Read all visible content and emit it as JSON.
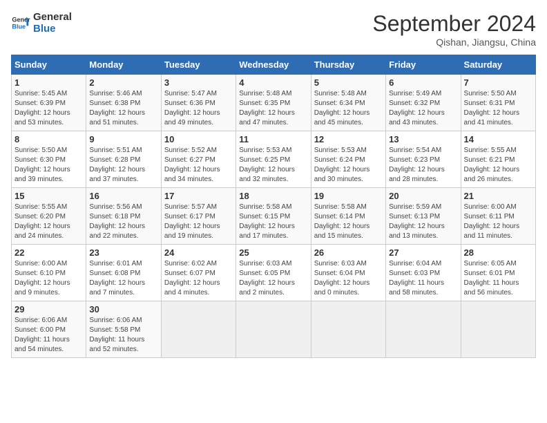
{
  "logo": {
    "line1": "General",
    "line2": "Blue"
  },
  "title": "September 2024",
  "location": "Qishan, Jiangsu, China",
  "weekdays": [
    "Sunday",
    "Monday",
    "Tuesday",
    "Wednesday",
    "Thursday",
    "Friday",
    "Saturday"
  ],
  "weeks": [
    [
      {
        "day": "1",
        "info": "Sunrise: 5:45 AM\nSunset: 6:39 PM\nDaylight: 12 hours\nand 53 minutes."
      },
      {
        "day": "2",
        "info": "Sunrise: 5:46 AM\nSunset: 6:38 PM\nDaylight: 12 hours\nand 51 minutes."
      },
      {
        "day": "3",
        "info": "Sunrise: 5:47 AM\nSunset: 6:36 PM\nDaylight: 12 hours\nand 49 minutes."
      },
      {
        "day": "4",
        "info": "Sunrise: 5:48 AM\nSunset: 6:35 PM\nDaylight: 12 hours\nand 47 minutes."
      },
      {
        "day": "5",
        "info": "Sunrise: 5:48 AM\nSunset: 6:34 PM\nDaylight: 12 hours\nand 45 minutes."
      },
      {
        "day": "6",
        "info": "Sunrise: 5:49 AM\nSunset: 6:32 PM\nDaylight: 12 hours\nand 43 minutes."
      },
      {
        "day": "7",
        "info": "Sunrise: 5:50 AM\nSunset: 6:31 PM\nDaylight: 12 hours\nand 41 minutes."
      }
    ],
    [
      {
        "day": "8",
        "info": "Sunrise: 5:50 AM\nSunset: 6:30 PM\nDaylight: 12 hours\nand 39 minutes."
      },
      {
        "day": "9",
        "info": "Sunrise: 5:51 AM\nSunset: 6:28 PM\nDaylight: 12 hours\nand 37 minutes."
      },
      {
        "day": "10",
        "info": "Sunrise: 5:52 AM\nSunset: 6:27 PM\nDaylight: 12 hours\nand 34 minutes."
      },
      {
        "day": "11",
        "info": "Sunrise: 5:53 AM\nSunset: 6:25 PM\nDaylight: 12 hours\nand 32 minutes."
      },
      {
        "day": "12",
        "info": "Sunrise: 5:53 AM\nSunset: 6:24 PM\nDaylight: 12 hours\nand 30 minutes."
      },
      {
        "day": "13",
        "info": "Sunrise: 5:54 AM\nSunset: 6:23 PM\nDaylight: 12 hours\nand 28 minutes."
      },
      {
        "day": "14",
        "info": "Sunrise: 5:55 AM\nSunset: 6:21 PM\nDaylight: 12 hours\nand 26 minutes."
      }
    ],
    [
      {
        "day": "15",
        "info": "Sunrise: 5:55 AM\nSunset: 6:20 PM\nDaylight: 12 hours\nand 24 minutes."
      },
      {
        "day": "16",
        "info": "Sunrise: 5:56 AM\nSunset: 6:18 PM\nDaylight: 12 hours\nand 22 minutes."
      },
      {
        "day": "17",
        "info": "Sunrise: 5:57 AM\nSunset: 6:17 PM\nDaylight: 12 hours\nand 19 minutes."
      },
      {
        "day": "18",
        "info": "Sunrise: 5:58 AM\nSunset: 6:15 PM\nDaylight: 12 hours\nand 17 minutes."
      },
      {
        "day": "19",
        "info": "Sunrise: 5:58 AM\nSunset: 6:14 PM\nDaylight: 12 hours\nand 15 minutes."
      },
      {
        "day": "20",
        "info": "Sunrise: 5:59 AM\nSunset: 6:13 PM\nDaylight: 12 hours\nand 13 minutes."
      },
      {
        "day": "21",
        "info": "Sunrise: 6:00 AM\nSunset: 6:11 PM\nDaylight: 12 hours\nand 11 minutes."
      }
    ],
    [
      {
        "day": "22",
        "info": "Sunrise: 6:00 AM\nSunset: 6:10 PM\nDaylight: 12 hours\nand 9 minutes."
      },
      {
        "day": "23",
        "info": "Sunrise: 6:01 AM\nSunset: 6:08 PM\nDaylight: 12 hours\nand 7 minutes."
      },
      {
        "day": "24",
        "info": "Sunrise: 6:02 AM\nSunset: 6:07 PM\nDaylight: 12 hours\nand 4 minutes."
      },
      {
        "day": "25",
        "info": "Sunrise: 6:03 AM\nSunset: 6:05 PM\nDaylight: 12 hours\nand 2 minutes."
      },
      {
        "day": "26",
        "info": "Sunrise: 6:03 AM\nSunset: 6:04 PM\nDaylight: 12 hours\nand 0 minutes."
      },
      {
        "day": "27",
        "info": "Sunrise: 6:04 AM\nSunset: 6:03 PM\nDaylight: 11 hours\nand 58 minutes."
      },
      {
        "day": "28",
        "info": "Sunrise: 6:05 AM\nSunset: 6:01 PM\nDaylight: 11 hours\nand 56 minutes."
      }
    ],
    [
      {
        "day": "29",
        "info": "Sunrise: 6:06 AM\nSunset: 6:00 PM\nDaylight: 11 hours\nand 54 minutes."
      },
      {
        "day": "30",
        "info": "Sunrise: 6:06 AM\nSunset: 5:58 PM\nDaylight: 11 hours\nand 52 minutes."
      },
      {
        "day": "",
        "info": ""
      },
      {
        "day": "",
        "info": ""
      },
      {
        "day": "",
        "info": ""
      },
      {
        "day": "",
        "info": ""
      },
      {
        "day": "",
        "info": ""
      }
    ]
  ]
}
